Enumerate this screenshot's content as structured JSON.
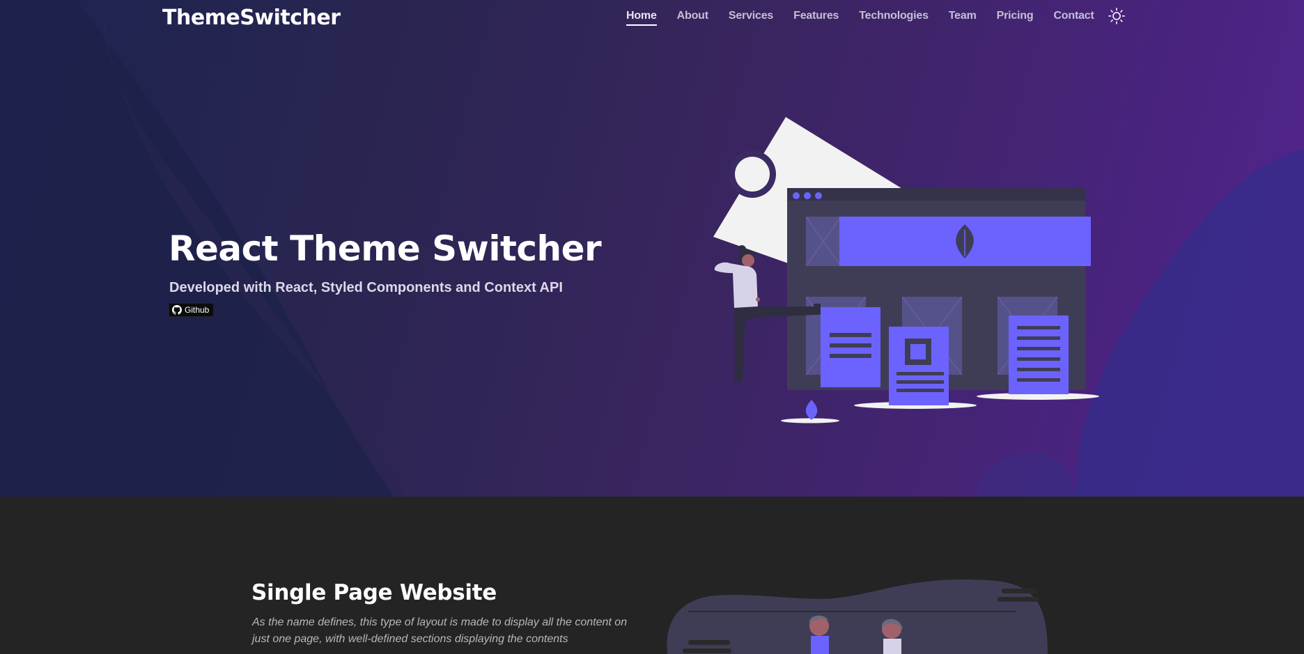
{
  "nav": {
    "brand": "ThemeSwitcher",
    "items": [
      {
        "label": "Home",
        "active": true
      },
      {
        "label": "About"
      },
      {
        "label": "Services"
      },
      {
        "label": "Features"
      },
      {
        "label": "Technologies"
      },
      {
        "label": "Team"
      },
      {
        "label": "Pricing"
      },
      {
        "label": "Contact"
      }
    ],
    "theme_icon": "sun-icon"
  },
  "hero": {
    "title": "React Theme Switcher",
    "subtitle": "Developed with React, Styled Components and Context API",
    "github_label": "Github",
    "github_icon": "github-icon",
    "illustration": "web-layout-illustration"
  },
  "section": {
    "title": "Single Page Website",
    "description": "As the name defines, this type of layout is made to display all the content on just one page, with well-defined sections displaying the contents"
  },
  "colors": {
    "accent": "#6c63ff",
    "hero_bg_start": "#1d2450",
    "hero_bg_end": "#552590",
    "section_bg": "#242424"
  }
}
